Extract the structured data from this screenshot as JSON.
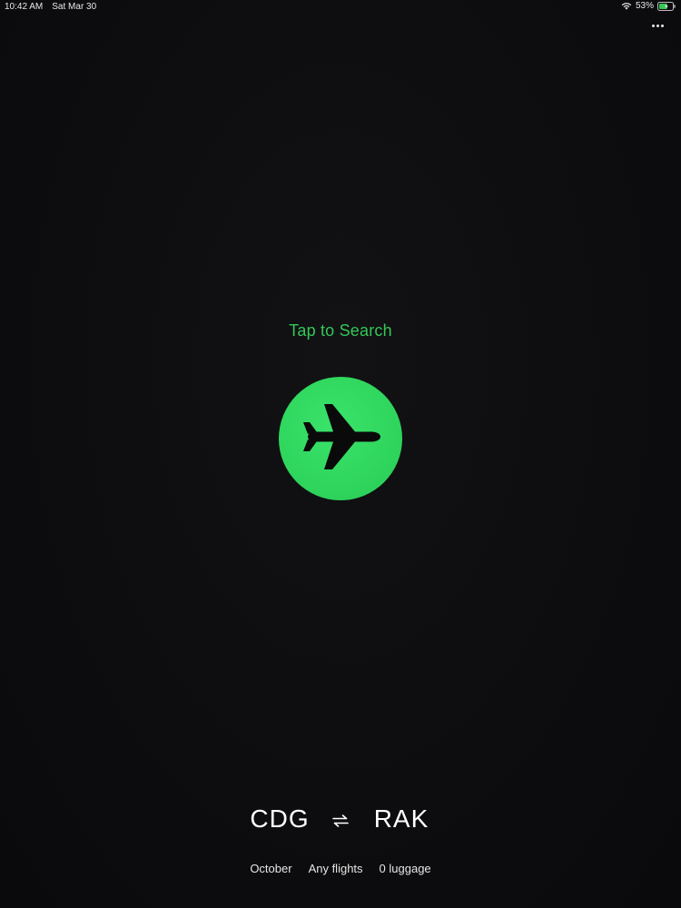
{
  "status_bar": {
    "time": "10:42 AM",
    "date": "Sat Mar 30",
    "battery": "53%"
  },
  "main": {
    "tap_label": "Tap to Search"
  },
  "route": {
    "origin": "CDG",
    "destination": "RAK"
  },
  "filters": {
    "month": "October",
    "flights": "Any flights",
    "luggage": "0 luggage"
  },
  "colors": {
    "accent": "#34c759",
    "background": "#0e0e10",
    "text": "#ffffff"
  },
  "icons": {
    "search": "airplane-icon",
    "swap": "swap-arrows-icon",
    "menu": "more-icon"
  }
}
